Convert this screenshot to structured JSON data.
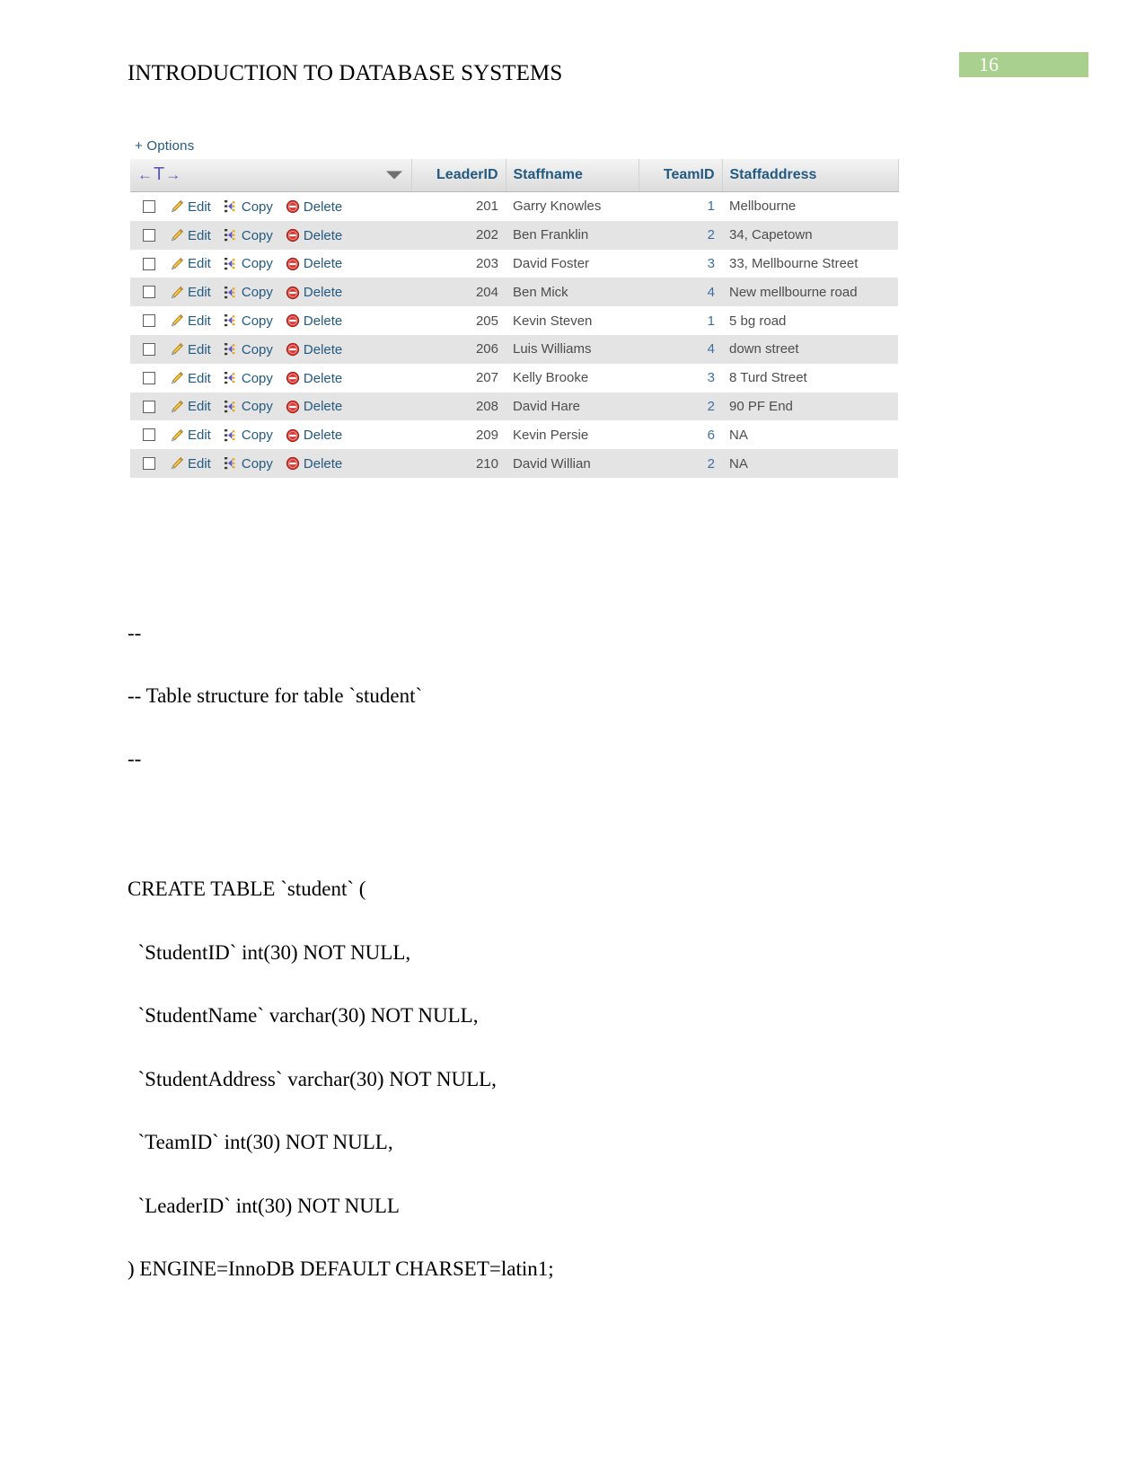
{
  "header": {
    "doc_title": "INTRODUCTION TO DATABASE SYSTEMS",
    "page_number": "16",
    "badge_color": "#a9d08e"
  },
  "pma": {
    "options_label": "+ Options",
    "nav_left_icon": "arrow-left-icon",
    "nav_t_icon": "t-toggle-icon",
    "nav_right_icon": "arrow-right-icon",
    "sort_icon": "chevron-down-icon",
    "actions_header": "",
    "columns": [
      "LeaderID",
      "Staffname",
      "TeamID",
      "Staffaddress"
    ],
    "actions": {
      "edit_label": "Edit",
      "copy_label": "Copy",
      "delete_label": "Delete",
      "edit_icon": "pencil-icon",
      "copy_icon": "copy-icon",
      "delete_icon": "delete-circle-icon",
      "checkbox_icon": "checkbox-unchecked-icon"
    },
    "rows": [
      {
        "leader_id": "201",
        "staffname": "Garry Knowles",
        "team_id": "1",
        "staffaddress": "Mellbourne"
      },
      {
        "leader_id": "202",
        "staffname": "Ben Franklin",
        "team_id": "2",
        "staffaddress": "34, Capetown"
      },
      {
        "leader_id": "203",
        "staffname": "David Foster",
        "team_id": "3",
        "staffaddress": "33, Mellbourne Street"
      },
      {
        "leader_id": "204",
        "staffname": "Ben Mick",
        "team_id": "4",
        "staffaddress": "New mellbourne road"
      },
      {
        "leader_id": "205",
        "staffname": "Kevin Steven",
        "team_id": "1",
        "staffaddress": "5 bg road"
      },
      {
        "leader_id": "206",
        "staffname": "Luis Williams",
        "team_id": "4",
        "staffaddress": "down street"
      },
      {
        "leader_id": "207",
        "staffname": "Kelly Brooke",
        "team_id": "3",
        "staffaddress": "8 Turd Street"
      },
      {
        "leader_id": "208",
        "staffname": "David Hare",
        "team_id": "2",
        "staffaddress": "90 PF End"
      },
      {
        "leader_id": "209",
        "staffname": "Kevin Persie",
        "team_id": "6",
        "staffaddress": "NA"
      },
      {
        "leader_id": "210",
        "staffname": "David Willian",
        "team_id": "2",
        "staffaddress": "NA"
      }
    ]
  },
  "comment_block": {
    "line1": "--",
    "line2": "-- Table structure for table `student`",
    "line3": "--"
  },
  "sql": {
    "line1": "CREATE TABLE `student` (",
    "line2": "  `StudentID` int(30) NOT NULL,",
    "line3": "  `StudentName` varchar(30) NOT NULL,",
    "line4": "  `StudentAddress` varchar(30) NOT NULL,",
    "line5": "  `TeamID` int(30) NOT NULL,",
    "line6": "  `LeaderID` int(30) NOT NULL",
    "line7": ") ENGINE=InnoDB DEFAULT CHARSET=latin1;"
  }
}
